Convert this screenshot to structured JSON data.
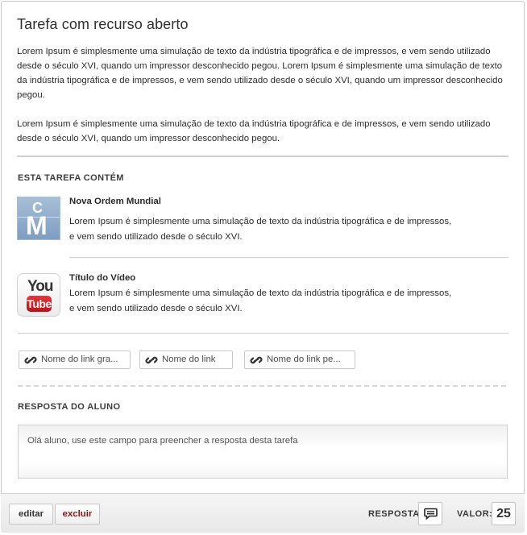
{
  "task": {
    "title": "Tarefa com recurso aberto",
    "paragraphs": [
      "Lorem Ipsum é simplesmente uma simulação de texto da indústria tipográfica e de impressos, e vem sendo utilizado desde o século XVI, quando um impressor desconhecido pegou. Lorem Ipsum é simplesmente uma simulação de texto da indústria tipográfica e de impressos, e vem sendo utilizado desde o século XVI, quando um impressor desconhecido pegou.",
      "Lorem Ipsum é simplesmente uma simulação de texto da indústria tipográfica e de impressos, e vem sendo utilizado desde o século XVI, quando um impressor desconhecido pegou."
    ]
  },
  "contents": {
    "label": "ESTA TAREFA CONTÉM",
    "items": [
      {
        "icon": "cm-document-icon",
        "icon_letters": [
          "C",
          "M"
        ],
        "title": "Nova Ordem Mundial",
        "description": "Lorem Ipsum é simplesmente uma simulação de texto da indústria tipográfica e de impressos, e vem sendo utilizado desde o século XVI."
      },
      {
        "icon": "youtube-icon",
        "icon_letters": [
          "You",
          "Tube"
        ],
        "title": "Título do Vídeo",
        "description": "Lorem Ipsum é simplesmente uma simulação de texto da indústria tipográfica e de impressos, e vem sendo utilizado desde o século XVI."
      }
    ],
    "links": [
      {
        "label": "Nome do link gra..."
      },
      {
        "label": "Nome do link"
      },
      {
        "label": "Nome do link pe..."
      }
    ]
  },
  "answer": {
    "label": "RESPOSTA DO ALUNO",
    "placeholder": "Olá aluno, use este campo para preencher a resposta desta tarefa"
  },
  "footer": {
    "edit_label": "editar",
    "delete_label": "excluir",
    "response_label": "RESPOSTA:",
    "value_label": "VALOR:",
    "value": "25",
    "delete_color": "#8e1616"
  }
}
